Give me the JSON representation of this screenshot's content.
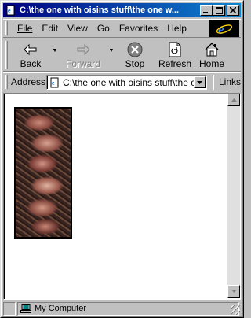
{
  "window": {
    "title": "C:\\the one with oisins stuff\\the one w...",
    "minimize_label": "_",
    "maximize_label": "□",
    "close_label": "✕"
  },
  "menu": {
    "items": [
      {
        "label": "File"
      },
      {
        "label": "Edit"
      },
      {
        "label": "View"
      },
      {
        "label": "Go"
      },
      {
        "label": "Favorites"
      },
      {
        "label": "Help"
      }
    ]
  },
  "toolbar": {
    "back_label": "Back",
    "forward_label": "Forward",
    "stop_label": "Stop",
    "refresh_label": "Refresh",
    "home_label": "Home"
  },
  "address": {
    "label": "Address",
    "value": "C:\\the one with oisins stuff\\the on",
    "links_label": "Links"
  },
  "status": {
    "zone_text": "My Computer"
  },
  "icons": {
    "ie": "ie-logo-icon",
    "back": "back-arrow-icon",
    "forward": "forward-arrow-icon",
    "stop": "stop-icon",
    "refresh": "refresh-icon",
    "home": "home-icon",
    "page": "page-icon",
    "computer": "computer-icon"
  },
  "colors": {
    "titlebar_start": "#000080",
    "titlebar_end": "#1084d0",
    "window_face": "#c0c0c0",
    "content_bg": "#ffffff"
  }
}
